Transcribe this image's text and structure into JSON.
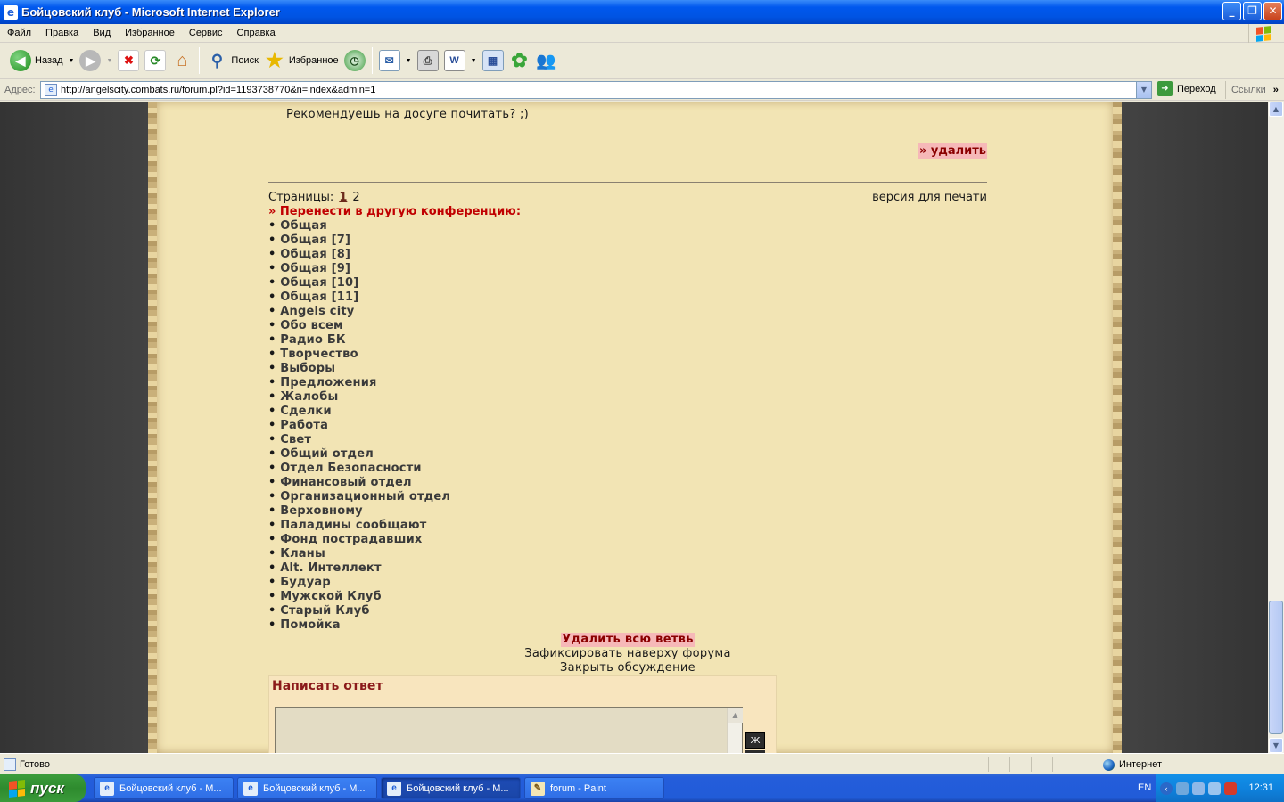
{
  "window": {
    "title": "Бойцовский клуб - Microsoft Internet Explorer"
  },
  "menu": [
    "Файл",
    "Правка",
    "Вид",
    "Избранное",
    "Сервис",
    "Справка"
  ],
  "toolbar": {
    "back": "Назад",
    "search": "Поиск",
    "favorites": "Избранное"
  },
  "address": {
    "label": "Адрес:",
    "url": "http://angelscity.combats.ru/forum.pl?id=1193738770&n=index&admin=1",
    "go": "Переход",
    "links": "Ссылки"
  },
  "page": {
    "post_text": "Рекомендуешь на досуге почитать? ;)",
    "delete_label": "» удалить",
    "pages_label": "Страницы:",
    "page_current": "1",
    "page_other": "2",
    "print_version": "версия для печати",
    "move_label": "» Перенести в другую конференцию:",
    "conferences": [
      "Общая",
      "Общая [7]",
      "Общая [8]",
      "Общая [9]",
      "Общая [10]",
      "Общая [11]",
      "Angels city",
      "Обо всем",
      "Радио БК",
      "Творчество",
      "Выборы",
      "Предложения",
      "Жалобы",
      "Сделки",
      "Работа",
      "Свет",
      "Общий отдел",
      "Отдел Безопасности",
      "Финансовый отдел",
      "Организационный отдел",
      "Верховному",
      "Паладины сообщают",
      "Фонд пострадавших",
      "Кланы",
      "Alt. Интеллект",
      "Будуар",
      "Мужской Клуб",
      "Старый Клуб",
      "Помойка"
    ],
    "delete_thread": "Удалить всю ветвь",
    "pin_top": "Зафиксировать наверху форума",
    "close_discussion": "Закрыть обсуждение",
    "reply_title": "Написать ответ",
    "bold_button": "Ж"
  },
  "status": {
    "text": "Готово",
    "zone": "Интернет"
  },
  "taskbar": {
    "start": "пуск",
    "items": [
      "Бойцовский клуб - M...",
      "Бойцовский клуб - M...",
      "Бойцовский клуб - M...",
      "forum - Paint"
    ],
    "lang": "EN",
    "clock": "12:31"
  },
  "colors": {
    "parchment": "#F2E4B4",
    "delete_bg": "#F6B8B8",
    "move_red": "#C00000",
    "xp_blue": "#0054E3"
  }
}
